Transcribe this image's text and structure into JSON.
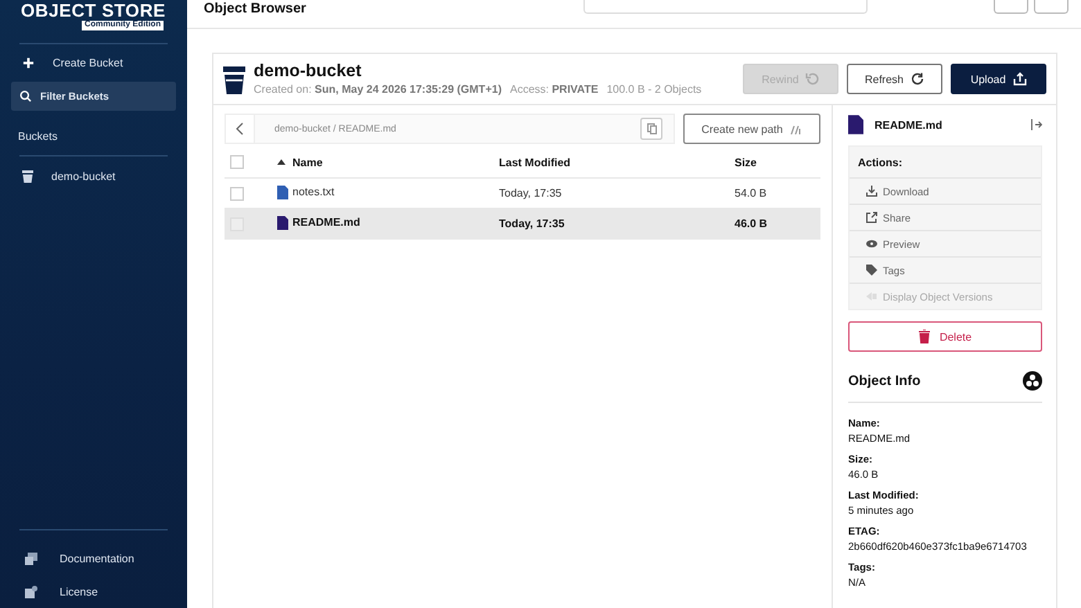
{
  "sidebar": {
    "logo": "OBJECT STORE",
    "edition": "Community Edition",
    "create_label": "Create Bucket",
    "filter_label": "Filter Buckets",
    "section": "Buckets",
    "buckets": [
      {
        "name": "demo-bucket",
        "selected": false
      }
    ],
    "footer": [
      {
        "label": "Documentation",
        "kind": "docs"
      },
      {
        "label": "License",
        "kind": "license"
      }
    ]
  },
  "header": {
    "title": "Object Browser"
  },
  "bucket": {
    "name": "demo-bucket",
    "created_label": "Created on:",
    "created": "Sun, May 24 2026 17:35:29 (GMT+1)",
    "access_label": "Access:",
    "access": "PRIVATE",
    "summary": "100.0 B - 2 Objects",
    "buttons": [
      {
        "label": "Rewind",
        "kind": "rewind",
        "disabled": true
      },
      {
        "label": "Refresh",
        "kind": "refresh",
        "disabled": false
      },
      {
        "label": "Upload",
        "kind": "upload",
        "disabled": false
      }
    ]
  },
  "browser": {
    "path": "demo-bucket / README.md",
    "create_path": "Create new path",
    "columns": [
      "Name",
      "Last Modified",
      "Size"
    ],
    "select_all_checked": false,
    "rows": [
      {
        "name": "notes.txt",
        "modified": "Today, 17:35",
        "size": "54.0 B",
        "color": "#2f5fb3",
        "selected": false,
        "checked": false
      },
      {
        "name": "README.md",
        "modified": "Today, 17:35",
        "size": "46.0 B",
        "color": "#2a1a6e",
        "selected": true,
        "checked": false
      }
    ]
  },
  "details": {
    "title": "README.md",
    "actions_label": "Actions:",
    "actions": [
      {
        "label": "Download",
        "kind": "download",
        "disabled": false
      },
      {
        "label": "Share",
        "kind": "share",
        "disabled": false
      },
      {
        "label": "Preview",
        "kind": "preview",
        "disabled": false
      },
      {
        "label": "Tags",
        "kind": "tags",
        "disabled": false
      },
      {
        "label": "Display Object Versions",
        "kind": "versions",
        "disabled": true
      }
    ],
    "delete_label": "Delete",
    "info_title": "Object Info",
    "fields": [
      {
        "label": "Name:",
        "value": "README.md"
      },
      {
        "label": "Size:",
        "value": "46.0 B"
      },
      {
        "label": "Last Modified:",
        "value": "5 minutes ago"
      },
      {
        "label": "ETAG:",
        "value": "2b660df620b460e373fc1ba9e6714703"
      },
      {
        "label": "Tags:",
        "value": "N/A"
      }
    ]
  }
}
